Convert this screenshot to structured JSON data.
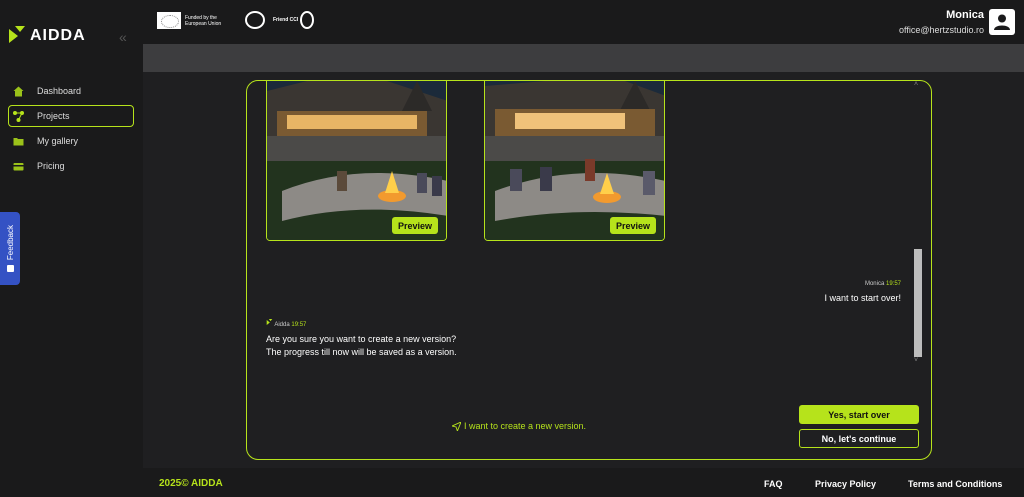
{
  "brand": {
    "name": "AIDDA",
    "accent": "#b6e31b"
  },
  "sidebar": {
    "collapse_glyph": "«",
    "items": [
      {
        "label": "Dashboard",
        "icon": "home-icon"
      },
      {
        "label": "Projects",
        "icon": "projects-icon",
        "active": true
      },
      {
        "label": "My gallery",
        "icon": "folder-icon"
      },
      {
        "label": "Pricing",
        "icon": "card-icon"
      }
    ],
    "feedback_label": "Feedback"
  },
  "header": {
    "eu_text": "Funded by the European Union",
    "partner_text": "Friend CCI",
    "user_name": "Monica",
    "user_email": "office@hertzstudio.ro"
  },
  "chat": {
    "images": [
      {
        "preview_label": "Preview"
      },
      {
        "preview_label": "Preview"
      }
    ],
    "user_message": {
      "author": "Monica",
      "time": "19:57",
      "text": "I want to start over!"
    },
    "bot_message": {
      "author": "Aidda",
      "time": "19:57",
      "lines": [
        "Are you sure you want to create a new version?",
        "The progress till now will be saved as a version."
      ]
    },
    "action_link": "I want to create a new version.",
    "yes_button": "Yes, start over",
    "no_button": "No, let's continue"
  },
  "footer": {
    "copyright": "2025© AIDDA",
    "links": [
      "FAQ",
      "Privacy Policy",
      "Terms and Conditions"
    ]
  }
}
